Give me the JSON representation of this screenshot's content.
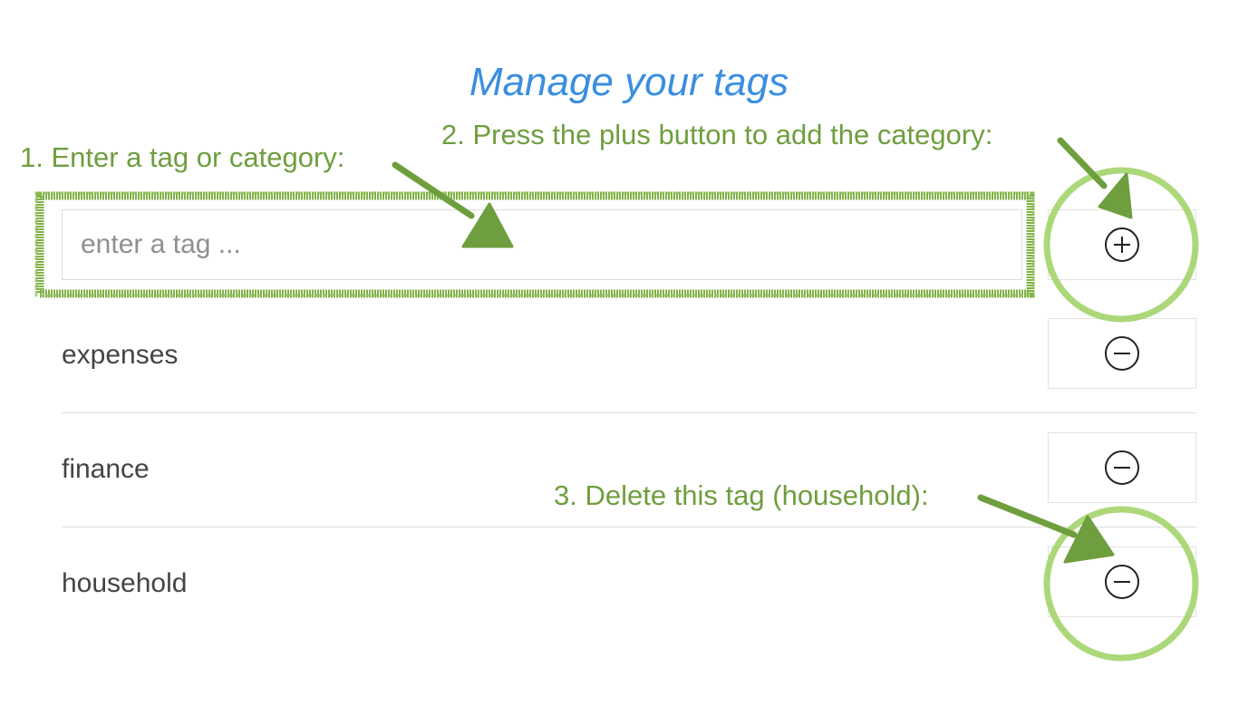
{
  "title": "Manage your tags",
  "annotations": {
    "step1": "1. Enter  a tag or category:",
    "step2": "2. Press the plus button to add the category:",
    "step3": "3. Delete this tag (household):"
  },
  "input": {
    "placeholder": "enter a tag ...",
    "value": ""
  },
  "add_button": {
    "icon": "plus-circle-icon"
  },
  "tags": [
    {
      "label": "expenses",
      "delete_icon": "minus-circle-icon"
    },
    {
      "label": "finance",
      "delete_icon": "minus-circle-icon"
    },
    {
      "label": "household",
      "delete_icon": "minus-circle-icon"
    }
  ],
  "colors": {
    "title": "#3a8ee0",
    "annotation_text": "#6f9e3e",
    "annotation_marker": "#7aad3e",
    "annotation_circle": "#9fd06a"
  }
}
